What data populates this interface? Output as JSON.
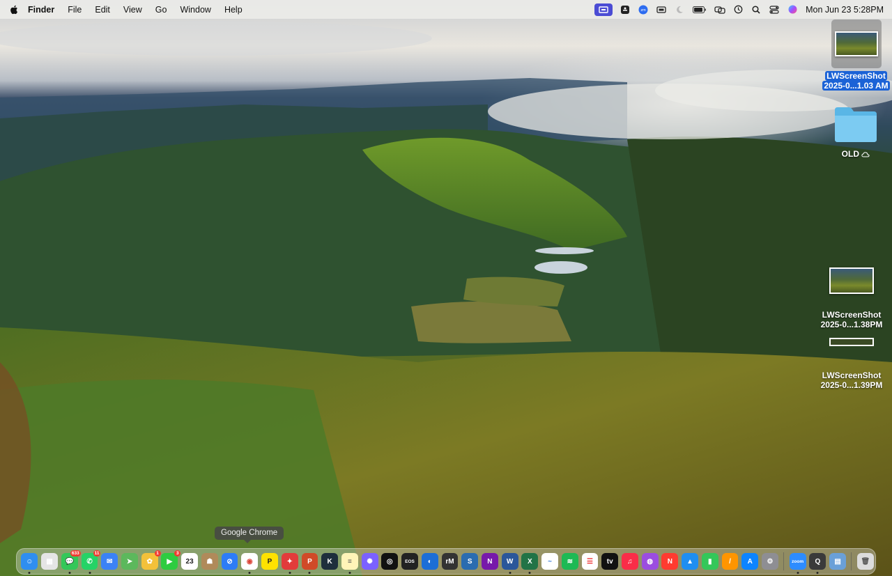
{
  "menubar": {
    "apple_icon": "apple-logo-icon",
    "app_name": "Finder",
    "menus": [
      "File",
      "Edit",
      "View",
      "Go",
      "Window",
      "Help"
    ],
    "status_icons": [
      "screen-recording-icon",
      "accessibility-icon",
      "zoom-status-icon",
      "display-icon",
      "moon-icon",
      "battery-icon",
      "screen-mirroring-icon",
      "time-machine-icon",
      "search-icon",
      "control-center-icon",
      "siri-icon"
    ],
    "clock": "Mon Jun 23  5:28PM"
  },
  "desktop": {
    "items": [
      {
        "label_line1": "LWScreenShot",
        "label_line2": "2025-0...1.03 AM",
        "selected": true
      },
      {
        "label_line1": "OLD",
        "icon": "folder-icon",
        "cloud_icon": "cloud-icon"
      },
      {
        "label_line1": "LWScreenShot",
        "label_line2": "2025-0...1.38PM"
      },
      {
        "label_line1": "LWScreenShot",
        "label_line2": "2025-0...1.39PM"
      }
    ]
  },
  "dock": {
    "tooltip": "Google Chrome",
    "apps": [
      {
        "name": "finder",
        "color": "#2f8ef0",
        "glyph": "☺",
        "running": true
      },
      {
        "name": "launchpad",
        "color": "#e5e5e5",
        "glyph": "▦"
      },
      {
        "name": "messages",
        "color": "#34c759",
        "glyph": "💬",
        "badge": "633",
        "running": true
      },
      {
        "name": "whatsapp",
        "color": "#25d366",
        "glyph": "✆",
        "badge": "11",
        "running": true
      },
      {
        "name": "mail",
        "color": "#3b82f6",
        "glyph": "✉"
      },
      {
        "name": "maps",
        "color": "#5cb85c",
        "glyph": "➤"
      },
      {
        "name": "photos",
        "color": "#f3c13a",
        "glyph": "✿",
        "badge": "1"
      },
      {
        "name": "facetime",
        "color": "#2ecc40",
        "glyph": "▶",
        "badge": "3"
      },
      {
        "name": "calendar",
        "color": "#ffffff",
        "glyph": "23",
        "text_color": "#222"
      },
      {
        "name": "contacts",
        "color": "#b08a5a",
        "glyph": "☗"
      },
      {
        "name": "safari",
        "color": "#2d7cf6",
        "glyph": "⊘"
      },
      {
        "name": "google-chrome",
        "color": "#ffffff",
        "glyph": "◉",
        "text_color": "#db4437",
        "running": true
      },
      {
        "name": "postit",
        "color": "#ffe200",
        "glyph": "P",
        "text_color": "#222"
      },
      {
        "name": "mindnode",
        "color": "#e23b3b",
        "glyph": "✦",
        "running": true
      },
      {
        "name": "powerpoint",
        "color": "#d04a28",
        "glyph": "P",
        "running": true
      },
      {
        "name": "app-k",
        "color": "#1e2e3c",
        "glyph": "K"
      },
      {
        "name": "notes",
        "color": "#fff4b8",
        "glyph": "≡",
        "text_color": "#555",
        "running": true
      },
      {
        "name": "perplexity",
        "color": "#7b61ff",
        "glyph": "✺"
      },
      {
        "name": "camo",
        "color": "#111",
        "glyph": "◎"
      },
      {
        "name": "eos-webcam",
        "color": "#222",
        "glyph": "EOS"
      },
      {
        "name": "screenflow",
        "color": "#1c6ed6",
        "glyph": "◐"
      },
      {
        "name": "remarkable",
        "color": "#333",
        "glyph": "rM"
      },
      {
        "name": "scrivener",
        "color": "#2b6cb0",
        "glyph": "S"
      },
      {
        "name": "onenote",
        "color": "#7719aa",
        "glyph": "N"
      },
      {
        "name": "word",
        "color": "#2b579a",
        "glyph": "W",
        "running": true
      },
      {
        "name": "excel",
        "color": "#217346",
        "glyph": "X",
        "running": true
      },
      {
        "name": "freeform",
        "color": "#ffffff",
        "glyph": "~",
        "text_color": "#3a7bd5"
      },
      {
        "name": "spotify",
        "color": "#1db954",
        "glyph": "≋"
      },
      {
        "name": "reminders",
        "color": "#ffffff",
        "glyph": "☰",
        "text_color": "#e33"
      },
      {
        "name": "apple-tv",
        "color": "#111",
        "glyph": "tv"
      },
      {
        "name": "music",
        "color": "#fa2d48",
        "glyph": "♫"
      },
      {
        "name": "podcasts",
        "color": "#9b4de0",
        "glyph": "◍"
      },
      {
        "name": "news",
        "color": "#ff3b30",
        "glyph": "N"
      },
      {
        "name": "keynote",
        "color": "#1f8ef1",
        "glyph": "▲"
      },
      {
        "name": "numbers",
        "color": "#34c759",
        "glyph": "▮"
      },
      {
        "name": "pages",
        "color": "#ff9500",
        "glyph": "/"
      },
      {
        "name": "app-store",
        "color": "#0d84ff",
        "glyph": "A"
      },
      {
        "name": "system-settings",
        "color": "#8e8e93",
        "glyph": "⚙"
      },
      {
        "name": "zoom",
        "color": "#2d8cff",
        "glyph": "zoom",
        "running": true
      },
      {
        "name": "quicktime",
        "color": "#3a3a3a",
        "glyph": "Q",
        "running": true
      },
      {
        "name": "preview",
        "color": "#6aa0d8",
        "glyph": "▤"
      },
      {
        "name": "trash",
        "color": "#dcdcdc",
        "glyph": "🗑",
        "text_color": "#555"
      }
    ]
  }
}
